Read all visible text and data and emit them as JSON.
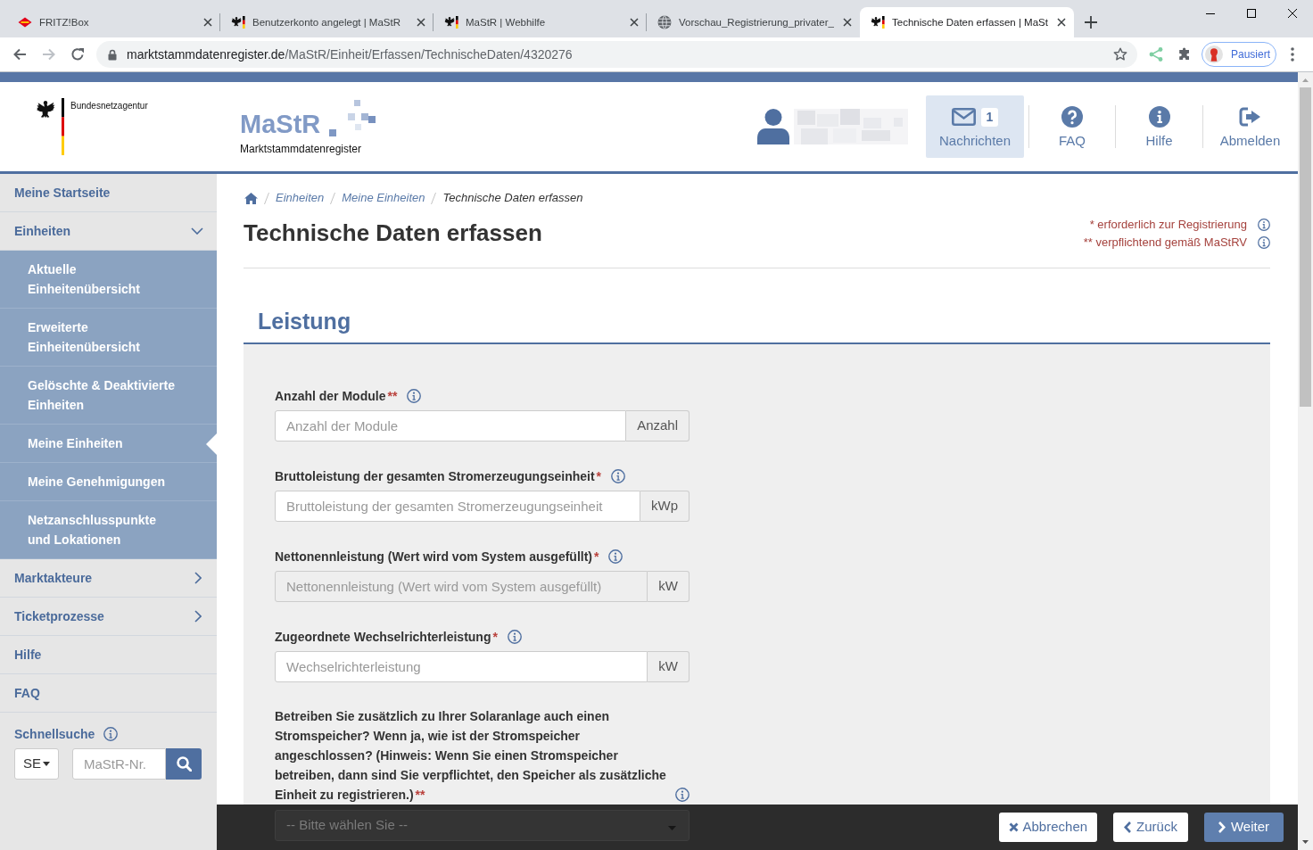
{
  "browser": {
    "tabs": [
      {
        "kind": "router",
        "title": "FRITZ!Box",
        "selected": false
      },
      {
        "kind": "agency",
        "title": "Benutzerkonto angelegt | MaStR",
        "selected": false
      },
      {
        "kind": "agency",
        "title": "MaStR | Webhilfe",
        "selected": false
      },
      {
        "kind": "web",
        "title": "Vorschau_Registrierung_privater_",
        "selected": false
      },
      {
        "kind": "agency",
        "title": "Technische Daten erfassen | MaSt",
        "selected": true
      }
    ],
    "address": {
      "host": "marktstammdatenregister.de",
      "path": "/MaStR/Einheit/Erfassen/TechnischeDaten/4320276"
    },
    "profile": {
      "label": "Pausiert"
    }
  },
  "header": {
    "agency": "Bundesnetzagentur",
    "logo": {
      "title": "MaStR",
      "subtitle": "Marktstammdatenregister"
    },
    "nav": [
      {
        "kind": "messages",
        "label": "Nachrichten",
        "badge": "1",
        "selected": true
      },
      {
        "kind": "faq",
        "label": "FAQ",
        "selected": false
      },
      {
        "kind": "help",
        "label": "Hilfe",
        "selected": false
      },
      {
        "kind": "logout",
        "label": "Abmelden",
        "selected": false
      }
    ]
  },
  "sidebar": {
    "items": [
      {
        "label": "Meine Startseite",
        "selected": false
      },
      {
        "label": "Einheiten",
        "selected": false,
        "expanded": true,
        "children": [
          {
            "label": "Aktuelle Einheitenübersicht",
            "selected": false
          },
          {
            "label": "Erweiterte Einheitenübersicht",
            "selected": false
          },
          {
            "label": "Gelöschte & Deaktivierte Einheiten",
            "selected": false
          },
          {
            "label": "Meine Einheiten",
            "selected": true
          },
          {
            "label": "Meine Genehmigungen",
            "selected": false
          },
          {
            "label": "Netzanschlusspunkte und Lokationen",
            "selected": false
          }
        ]
      },
      {
        "label": "Marktakteure",
        "selected": false,
        "expanded": false
      },
      {
        "label": "Ticketprozesse",
        "selected": false,
        "expanded": false
      },
      {
        "label": "Hilfe",
        "selected": false
      },
      {
        "label": "FAQ",
        "selected": false
      }
    ],
    "quick_search": {
      "label": "Schnellsuche",
      "type": "SE",
      "placeholder": "MaStR-Nr."
    }
  },
  "main": {
    "breadcrumb": [
      {
        "label": "Einheiten",
        "current": false
      },
      {
        "label": "Meine Einheiten",
        "current": false
      },
      {
        "label": "Technische Daten erfassen",
        "current": true
      }
    ],
    "title": "Technische Daten erfassen",
    "legend": [
      "* erforderlich zur Registrierung",
      "** verpflichtend gemäß MaStRV"
    ],
    "section": {
      "title": "Leistung",
      "fields": [
        {
          "kind": "input",
          "label": "Anzahl der Module",
          "marker": "**",
          "placeholder": "Anzahl der Module",
          "unit": "Anzahl",
          "disabled": false
        },
        {
          "kind": "input",
          "label": "Bruttoleistung der gesamten Stromerzeugungseinheit",
          "marker": "*",
          "placeholder": "Bruttoleistung der gesamten Stromerzeugungseinheit",
          "unit": "kWp",
          "disabled": false
        },
        {
          "kind": "input",
          "label": "Nettonennleistung (Wert wird vom System ausgefüllt)",
          "marker": "*",
          "placeholder": "Nettonennleistung (Wert wird vom System ausgefüllt)",
          "unit": "kW",
          "disabled": true
        },
        {
          "kind": "input",
          "label": "Zugeordnete Wechselrichterleistung",
          "marker": "*",
          "placeholder": "Wechselrichterleistung",
          "unit": "kW",
          "disabled": false
        },
        {
          "kind": "select",
          "label": "Betreiben Sie zusätzlich zu Ihrer Solaranlage auch einen Stromspeicher? Wenn ja, wie ist der Stromspeicher angeschlossen? (Hinweis: Wenn Sie einen Stromspeicher betreiben, dann sind Sie verpflichtet, den Speicher als zusätzliche Einheit zu registrieren.)",
          "marker": "**",
          "value": "-- Bitte wählen Sie --"
        }
      ]
    }
  },
  "footer": {
    "buttons": [
      {
        "kind": "cancel",
        "label": "Abbrechen"
      },
      {
        "kind": "back",
        "label": "Zurück"
      },
      {
        "kind": "next",
        "label": "Weiter"
      }
    ]
  }
}
